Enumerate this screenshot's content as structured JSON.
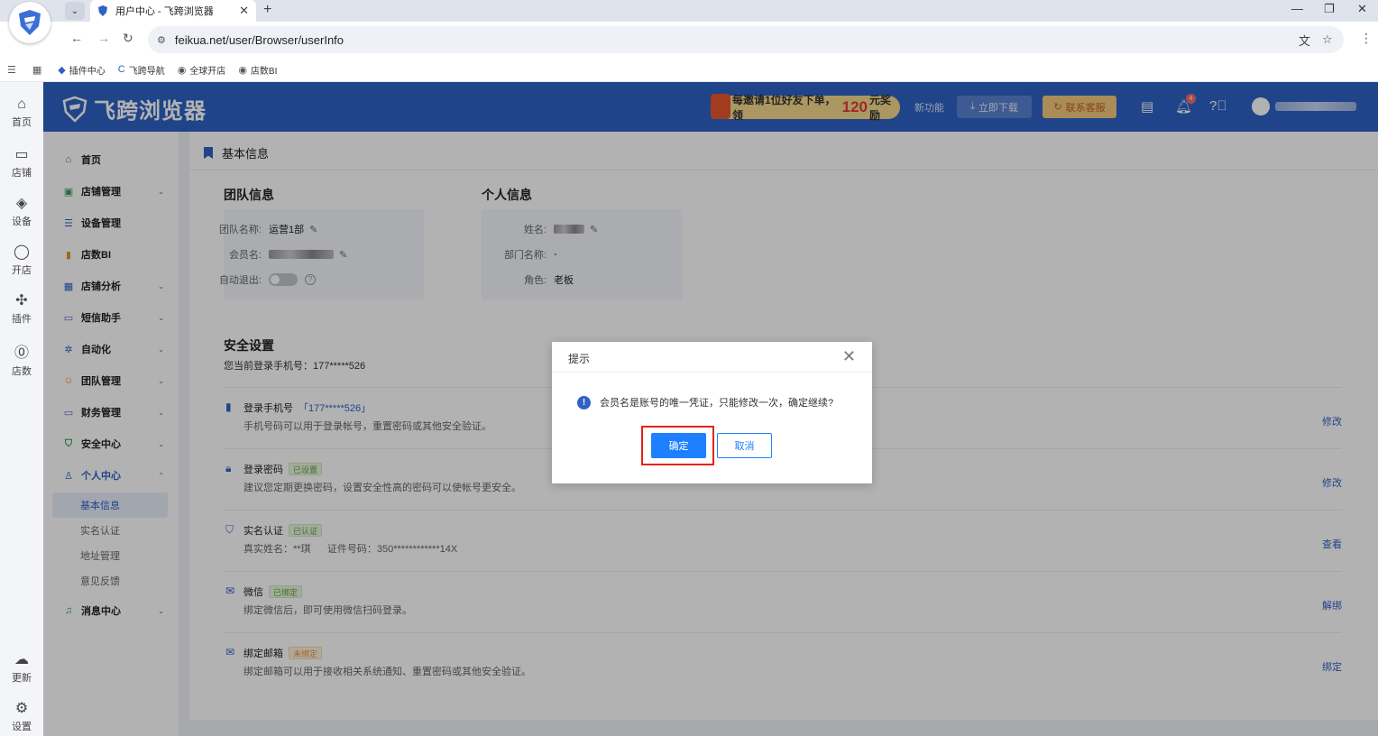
{
  "browser": {
    "tab_title": "用户中心 - 飞跨浏览器",
    "url": "feikua.net/user/Browser/userInfo",
    "bookmarks": [
      {
        "icon": "shield-icon",
        "label": "插件中心"
      },
      {
        "icon": "c-logo-icon",
        "label": "飞跨导航"
      },
      {
        "icon": "globe-icon",
        "label": "全球开店"
      },
      {
        "icon": "globe-icon",
        "label": "店数BI"
      }
    ]
  },
  "rail": {
    "items": [
      {
        "label": "首页",
        "icon": "home-icon"
      },
      {
        "label": "店铺",
        "icon": "store-icon"
      },
      {
        "label": "设备",
        "icon": "layers-icon"
      },
      {
        "label": "开店",
        "icon": "planet-icon"
      },
      {
        "label": "插件",
        "icon": "puzzle-icon"
      },
      {
        "label": "店数",
        "icon": "bi-icon"
      },
      {
        "label": "更新",
        "icon": "cloud-icon"
      },
      {
        "label": "设置",
        "icon": "gear-icon"
      }
    ]
  },
  "header": {
    "brand": "飞跨浏览器",
    "promo_prefix": "每邀请1位好友下单，领",
    "promo_amount": "120",
    "promo_suffix": "元奖励",
    "new_features": "新功能",
    "download": "立即下载",
    "contact": "联系客服",
    "notif_count": "4"
  },
  "sidenav": {
    "items": [
      {
        "label": "首页",
        "icon": "home-icon"
      },
      {
        "label": "店铺管理",
        "icon": "store-icon"
      },
      {
        "label": "设备管理",
        "icon": "server-icon"
      },
      {
        "label": "店数BI",
        "icon": "bar-chart-icon"
      },
      {
        "label": "店铺分析",
        "icon": "grid-icon"
      },
      {
        "label": "短信助手",
        "icon": "message-icon"
      },
      {
        "label": "自动化",
        "icon": "sun-icon"
      },
      {
        "label": "团队管理",
        "icon": "team-icon"
      },
      {
        "label": "财务管理",
        "icon": "wallet-icon"
      },
      {
        "label": "安全中心",
        "icon": "shield-check-icon"
      },
      {
        "label": "个人中心",
        "icon": "user-icon"
      },
      {
        "label": "消息中心",
        "icon": "bell-icon"
      }
    ],
    "sub_items": [
      "基本信息",
      "实名认证",
      "地址管理",
      "意见反馈"
    ]
  },
  "page": {
    "title": "基本信息",
    "team_title": "团队信息",
    "team_name_label": "团队名称:",
    "team_name": "运营1部",
    "member_label": "会员名:",
    "auto_logout_label": "自动退出:",
    "personal_title": "个人信息",
    "name_label": "姓名:",
    "dept_label": "部门名称:",
    "dept": "-",
    "role_label": "角色:",
    "role": "老板",
    "security_title": "安全设置",
    "security_phone": "您当前登录手机号：177*****526",
    "rows": [
      {
        "title": "登录手机号",
        "link": "「177*****526」",
        "tag": "",
        "desc": "手机号码可以用于登录帐号，重置密码或其他安全验证。",
        "action": "修改"
      },
      {
        "title": "登录密码",
        "link": "",
        "tag": "已设置",
        "desc": "建议您定期更换密码，设置安全性高的密码可以使帐号更安全。",
        "action": "修改"
      },
      {
        "title": "实名认证",
        "link": "",
        "tag": "已认证",
        "desc": "真实姓名：**琪      证件号码：350************14X",
        "action": "查看"
      },
      {
        "title": "微信",
        "link": "",
        "tag": "已绑定",
        "desc": "绑定微信后，即可使用微信扫码登录。",
        "action": "解绑"
      },
      {
        "title": "绑定邮箱",
        "link": "",
        "tag": "未绑定",
        "desc": "绑定邮箱可以用于接收相关系统通知、重置密码或其他安全验证。",
        "action": "绑定"
      }
    ]
  },
  "dialog": {
    "title": "提示",
    "message": "会员名是账号的唯一凭证，只能修改一次，确定继续?",
    "confirm": "确定",
    "cancel": "取消"
  }
}
